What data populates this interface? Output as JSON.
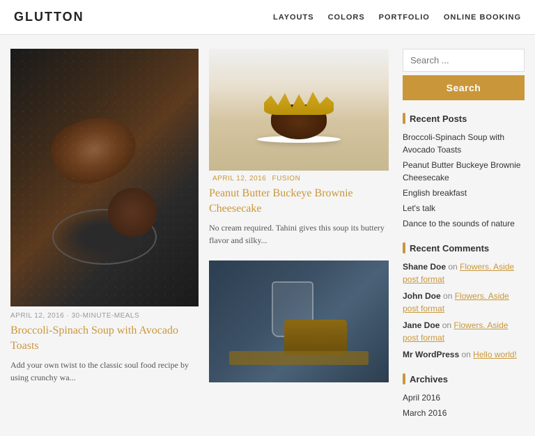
{
  "header": {
    "logo": "GLUTTON",
    "nav": [
      {
        "label": "LAYOUTS",
        "href": "#"
      },
      {
        "label": "COLORS",
        "href": "#"
      },
      {
        "label": "PORTFOLIO",
        "href": "#"
      },
      {
        "label": "ONLINE BOOKING",
        "href": "#"
      }
    ]
  },
  "featured_post": {
    "meta": "APRIL 12, 2016 · 30-MINUTE-MEALS",
    "title": "Broccoli-Spinach Soup with Avocado Toasts",
    "excerpt": "Add your own twist to the classic soul food recipe by using crunchy wa..."
  },
  "posts": [
    {
      "meta_date": "APRIL 12, 2016",
      "meta_cat": "FUSION",
      "title": "Peanut Butter Buckeye Brownie Cheesecake",
      "excerpt": "No cream required. Tahini gives this soup its buttery flavor and silky..."
    }
  ],
  "sidebar": {
    "search_placeholder": "Search ...",
    "search_button": "Search",
    "recent_posts_title": "Recent Posts",
    "recent_posts": [
      "Broccoli-Spinach Soup with Avocado Toasts",
      "Peanut Butter Buckeye Brownie Cheesecake",
      "English breakfast",
      "Let's talk",
      "Dance to the sounds of nature"
    ],
    "recent_comments_title": "Recent Comments",
    "recent_comments": [
      {
        "author": "Shane Doe",
        "on": "Flowers. Aside post format"
      },
      {
        "author": "John Doe",
        "on": "Flowers. Aside post format"
      },
      {
        "author": "Jane Doe",
        "on": "Flowers. Aside post format"
      },
      {
        "author": "Mr WordPress",
        "on": "Hello world!"
      }
    ],
    "archives_title": "Archives",
    "archives": [
      "April 2016",
      "March 2016"
    ]
  }
}
